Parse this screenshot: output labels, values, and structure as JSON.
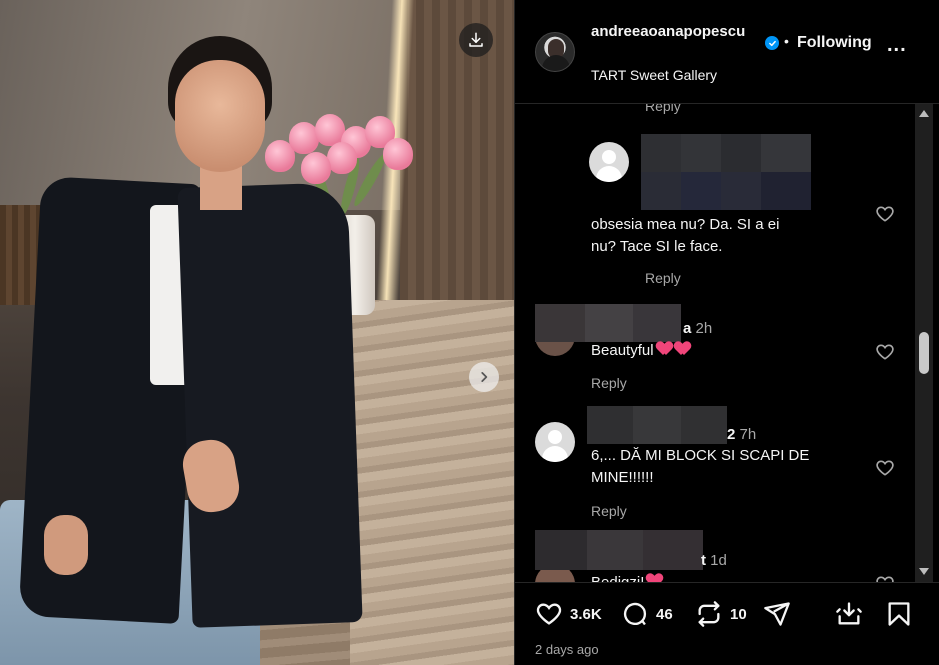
{
  "post": {
    "username_line1": "andreeaoanapopesc",
    "username_line2": "u",
    "follow_dot": "•",
    "follow_status": "Following",
    "more_label": "...",
    "location": "TART Sweet Gallery"
  },
  "comments": [
    {
      "reply": "Reply"
    },
    {
      "text_line1": "obsesia mea nu? Da. SI a ei",
      "text_line2": "nu? Tace SI le face.",
      "reply": "Reply"
    },
    {
      "name_suffix": "a",
      "time": "2h",
      "text": "Beautyful",
      "reply": "Reply"
    },
    {
      "name_suffix": "2",
      "time": "7h",
      "text_line1": "6,... DĂ MI BLOCK SI SCAPI DE",
      "text_line2": "MINE!!!!!!",
      "reply": "Reply"
    },
    {
      "name_suffix": "t",
      "time": "1d",
      "text": "Bedigzi!"
    }
  ],
  "actions": {
    "likes": "3.6K",
    "comments": "46",
    "reposts": "10"
  },
  "date": "2 days ago",
  "colors": {
    "background": "#000000",
    "text": "#f5f5f5",
    "secondary_text": "#a8a8a8",
    "verified": "#0095f6",
    "heart_emoji": "#f0457a"
  },
  "icons": [
    "download-icon",
    "chevron-right-icon",
    "verified-badge-icon",
    "more-icon",
    "heart-icon",
    "comment-icon",
    "repost-icon",
    "share-icon",
    "save-to-collection-icon",
    "bookmark-icon",
    "default-avatar-icon"
  ]
}
